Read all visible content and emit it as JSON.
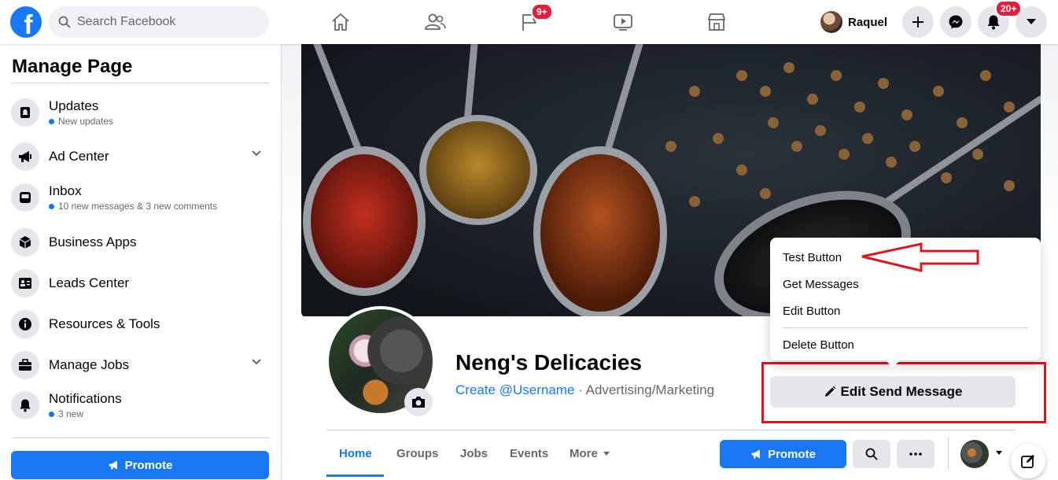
{
  "header": {
    "search_placeholder": "Search Facebook",
    "user_name": "Raquel",
    "badges": {
      "pages": "9+",
      "notifications": "20+"
    }
  },
  "sidebar": {
    "title": "Manage Page",
    "items": [
      {
        "label": "Updates",
        "sub": "New updates",
        "icon": "updates-icon"
      },
      {
        "label": "Ad Center",
        "sub": "",
        "icon": "megaphone-icon"
      },
      {
        "label": "Inbox",
        "sub": "10 new messages & 3 new comments",
        "icon": "inbox-icon"
      },
      {
        "label": "Business Apps",
        "sub": "",
        "icon": "cube-icon"
      },
      {
        "label": "Leads Center",
        "sub": "",
        "icon": "id-card-icon"
      },
      {
        "label": "Resources & Tools",
        "sub": "",
        "icon": "info-icon"
      },
      {
        "label": "Manage Jobs",
        "sub": "",
        "icon": "briefcase-icon"
      },
      {
        "label": "Notifications",
        "sub": "3 new",
        "icon": "bell-icon"
      }
    ],
    "promote_label": "Promote"
  },
  "page": {
    "name": "Neng's Delicacies",
    "username_link": "Create @Username",
    "category": " · Advertising/Marketing",
    "edit_button_label": "Edit Send Message"
  },
  "dropdown": {
    "items": [
      "Test Button",
      "Get Messages",
      "Edit Button",
      "Delete Button"
    ]
  },
  "tabs": [
    "Home",
    "Groups",
    "Jobs",
    "Events",
    "More"
  ],
  "actions": {
    "promote_label": "Promote"
  },
  "colors": {
    "brand": "#1877f2",
    "annotation": "#e0141e",
    "badge": "#e41e3f"
  }
}
